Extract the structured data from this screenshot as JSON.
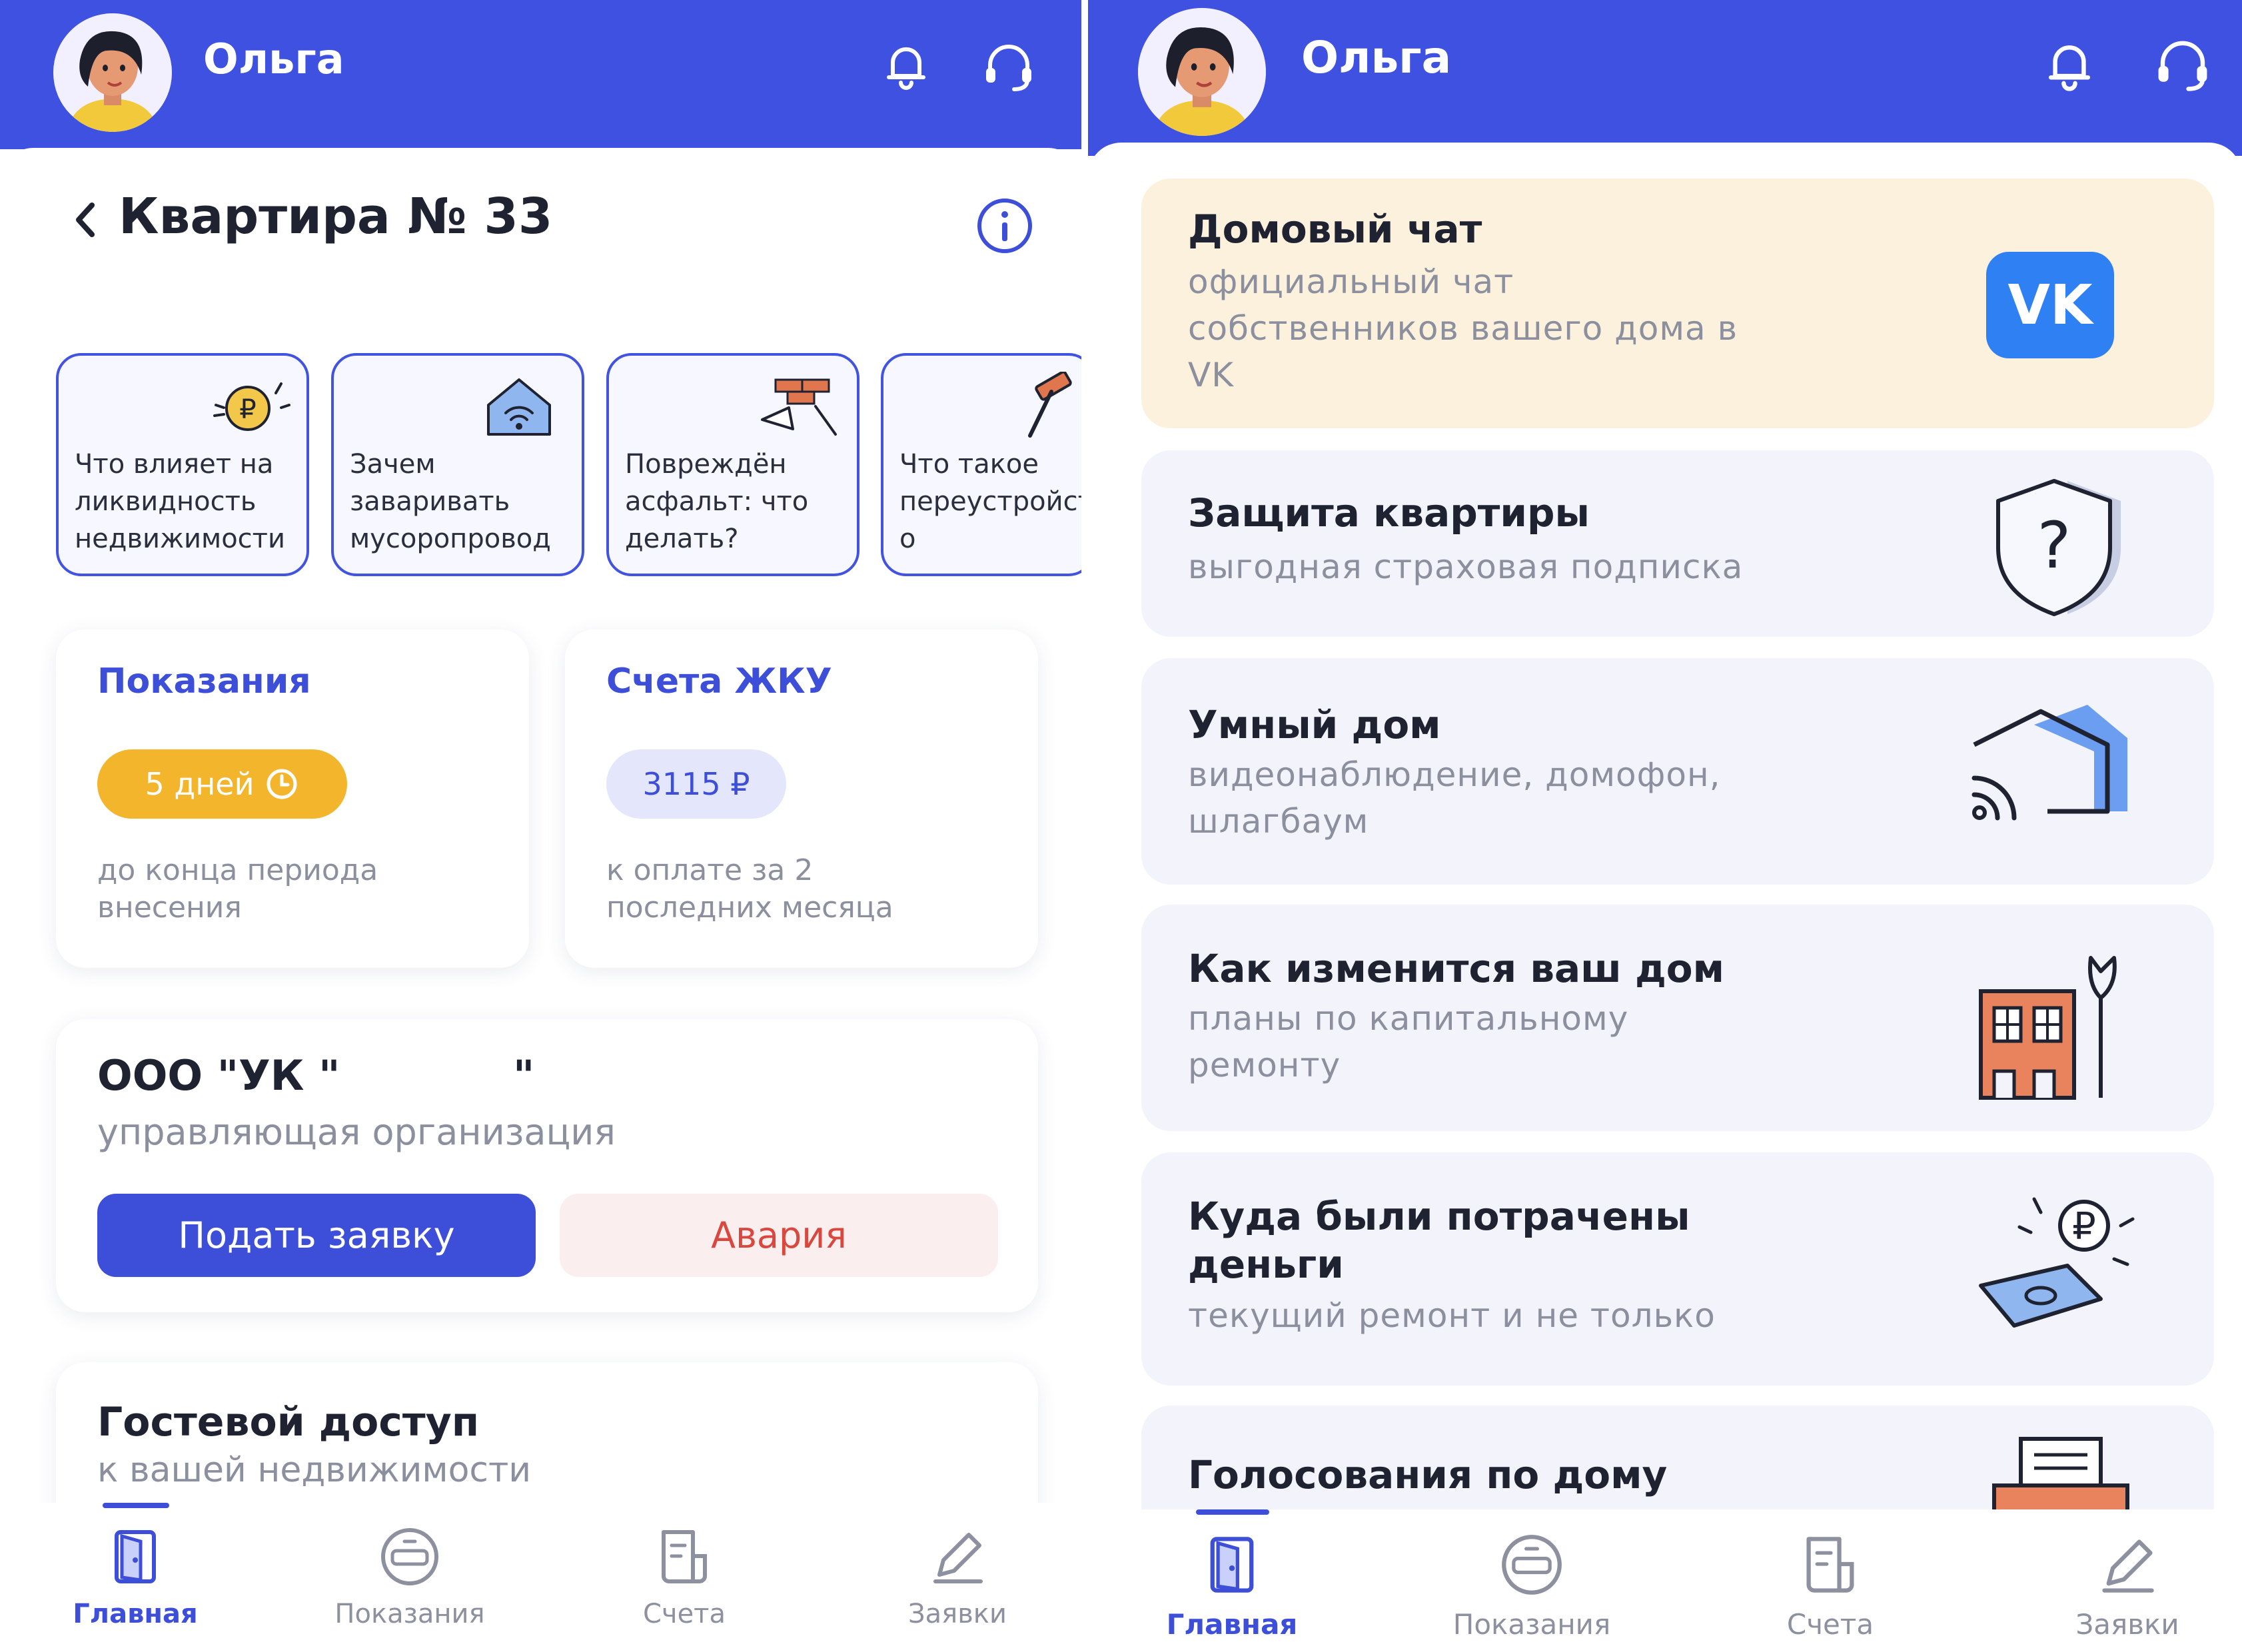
{
  "user": {
    "name": "Ольга"
  },
  "left": {
    "page_title": "Квартира № 33",
    "stories": [
      {
        "text": "Что влияет на\nликвидность\nнедвижимости"
      },
      {
        "text": "Зачем\nзаваривать\nмусоропровод"
      },
      {
        "text": "Повреждён\nасфальт: что\nделать?"
      },
      {
        "text": "Что такое\nпереустройст\nо"
      }
    ],
    "readings": {
      "title": "Показания",
      "badge": "5 дней",
      "caption": "до конца периода\nвнесения"
    },
    "bills": {
      "title": "Счета ЖКУ",
      "amount": "3115 ₽",
      "caption": "к оплате за 2\nпоследних месяца"
    },
    "company": {
      "name": "ООО \"УК \"",
      "closing_quote": "\"",
      "role": "управляющая организация",
      "request_button": "Подать заявку",
      "emergency_button": "Авария"
    },
    "guest": {
      "title": "Гостевой доступ",
      "subtitle": "к вашей недвижимости"
    }
  },
  "right": {
    "services": [
      {
        "title": "Домовый чат",
        "subtitle": "официальный чат\nсобственников вашего дома в\nVK",
        "icon": "vk-icon"
      },
      {
        "title": "Защита квартиры",
        "subtitle": "выгодная страховая подписка",
        "icon": "shield-question-icon"
      },
      {
        "title": "Умный дом",
        "subtitle": "видеонаблюдение, домофон,\nшлагбаум",
        "icon": "smart-home-icon"
      },
      {
        "title": "Как изменится ваш дом",
        "subtitle": "планы по капитальному\nремонту",
        "icon": "building-wrench-icon"
      },
      {
        "title": "Куда были потрачены\nденьги",
        "subtitle": "текущий ремонт и не только",
        "icon": "money-icon"
      },
      {
        "title": "Голосования по дому",
        "subtitle": "",
        "icon": "ballot-box-icon"
      }
    ]
  },
  "tabs": [
    {
      "label": "Главная",
      "icon": "door-icon",
      "active": true
    },
    {
      "label": "Показания",
      "icon": "meter-icon",
      "active": false
    },
    {
      "label": "Счета",
      "icon": "invoice-icon",
      "active": false
    },
    {
      "label": "Заявки",
      "icon": "pencil-icon",
      "active": false
    }
  ],
  "colors": {
    "brand": "#3f51e0",
    "accent_yellow": "#f3b52b",
    "chat_card": "#fbf1dc",
    "emergency_text": "#d8483e",
    "emergency_bg": "#fbeeee"
  }
}
